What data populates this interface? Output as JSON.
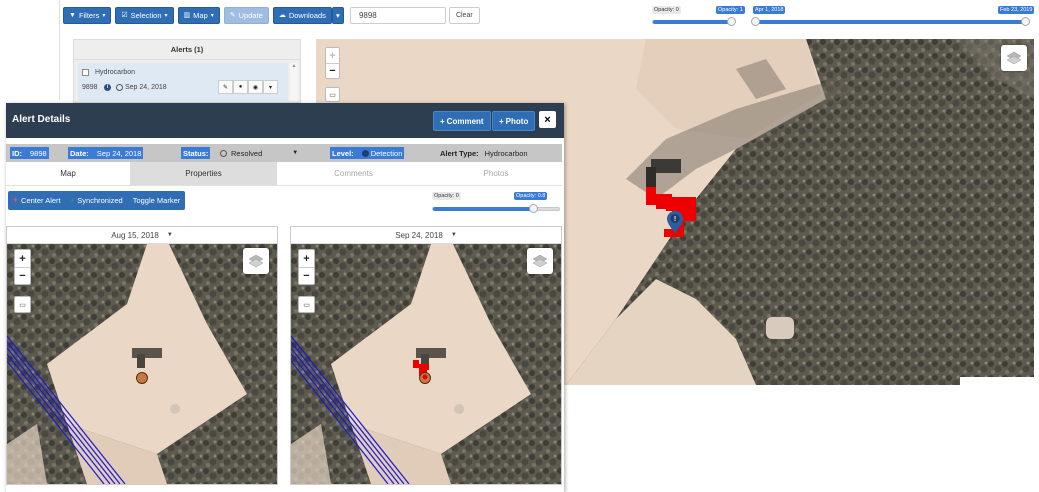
{
  "toolbar": {
    "filters_label": "Filters",
    "selection_label": "Selection",
    "map_label": "Map",
    "update_label": "Update",
    "downloads_label": "Downloads",
    "search_value": "9898",
    "clear_label": "Clear"
  },
  "opacity_slider": {
    "left_label": "Opacity: 0",
    "right_label": "Opacity: 1",
    "value": 1
  },
  "date_slider": {
    "start_label": "Apr 1, 2018",
    "end_label": "Feb 23, 2019"
  },
  "alerts_panel": {
    "title": "Alerts (1)",
    "items": [
      {
        "type": "Hydrocarbon",
        "id": "9898",
        "info_badge": "i",
        "date": "Sep 24, 2018"
      }
    ]
  },
  "modal": {
    "title": "Alert Details",
    "comment_button": "Comment",
    "photo_button": "Photo",
    "close_label": "×",
    "info": {
      "id_label": "ID:",
      "id_value": "9898",
      "date_label": "Date:",
      "date_value": "Sep 24, 2018",
      "status_label": "Status:",
      "status_value": "Resolved",
      "level_label": "Level:",
      "level_value": "Detection",
      "alert_type_label": "Alert Type:",
      "alert_type_value": "Hydrocarbon"
    },
    "tabs": [
      {
        "label": "Map"
      },
      {
        "label": "Properties"
      },
      {
        "label": "Comments"
      },
      {
        "label": "Photos"
      }
    ],
    "controls": {
      "center_alert": "Center Alert",
      "synchronized": "Synchronized",
      "toggle_marker": "Toggle Marker"
    },
    "opacity": {
      "left_label": "Opacity: 0",
      "right_label": "Opacity: 0.8",
      "value": 0.8
    },
    "maps": [
      {
        "date": "Aug 15, 2018"
      },
      {
        "date": "Sep 24, 2018"
      }
    ]
  },
  "colors": {
    "primary": "#2f6db5",
    "header_dark": "#2c3e50",
    "highlight": "#3a7bd5",
    "alert_red": "#e00000",
    "pipeline_blue": "#1a1ad6"
  }
}
